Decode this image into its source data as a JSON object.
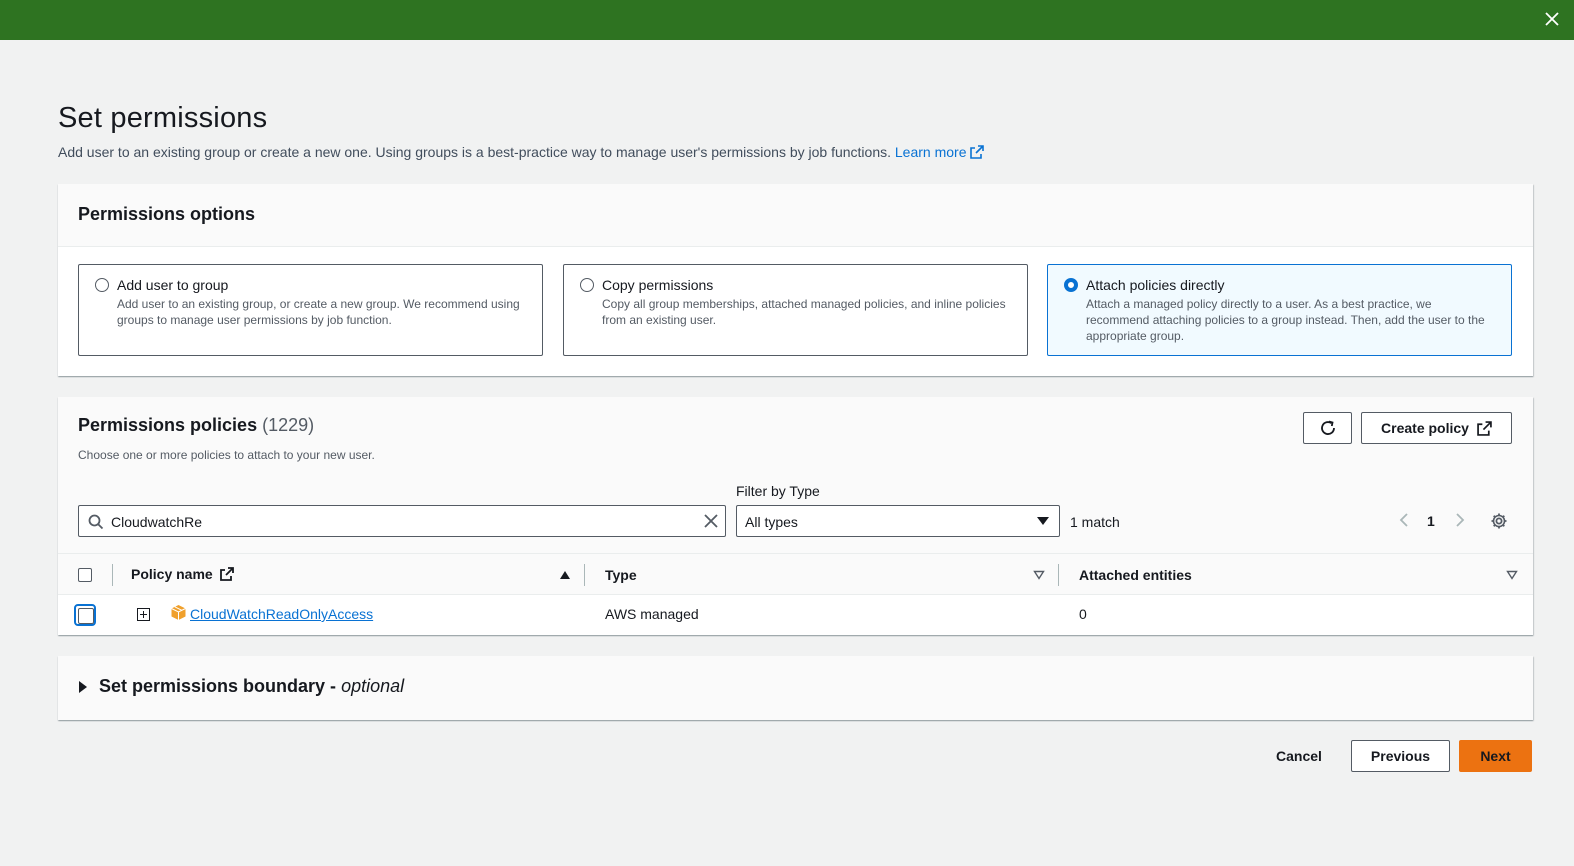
{
  "page": {
    "title": "Set permissions",
    "subtitle": "Add user to an existing group or create a new one. Using groups is a best-practice way to manage user's permissions by job functions.",
    "learn_more": "Learn more"
  },
  "permissions_options": {
    "heading": "Permissions options",
    "tiles": [
      {
        "label": "Add user to group",
        "desc": "Add user to an existing group, or create a new group. We recommend using groups to manage user permissions by job function.",
        "selected": false
      },
      {
        "label": "Copy permissions",
        "desc": "Copy all group memberships, attached managed policies, and inline policies from an existing user.",
        "selected": false
      },
      {
        "label": "Attach policies directly",
        "desc": "Attach a managed policy directly to a user. As a best practice, we recommend attaching policies to a group instead. Then, add the user to the appropriate group.",
        "selected": true
      }
    ]
  },
  "policies": {
    "heading": "Permissions policies",
    "count": "(1229)",
    "description": "Choose one or more policies to attach to your new user.",
    "create_policy_label": "Create policy",
    "search_value": "CloudwatchRe",
    "filter_label": "Filter by Type",
    "filter_value": "All types",
    "matches": "1 match",
    "page_number": "1",
    "columns": {
      "policy_name": "Policy name",
      "type": "Type",
      "attached_entities": "Attached entities"
    },
    "rows": [
      {
        "name": "CloudWatchReadOnlyAccess",
        "type": "AWS managed",
        "attached": "0"
      }
    ]
  },
  "boundary": {
    "title": "Set permissions boundary - ",
    "optional": "optional"
  },
  "footer": {
    "cancel": "Cancel",
    "previous": "Previous",
    "next": "Next"
  },
  "colors": {
    "banner": "#2e7321",
    "link": "#0972d3",
    "primary_button": "#ec7211"
  }
}
